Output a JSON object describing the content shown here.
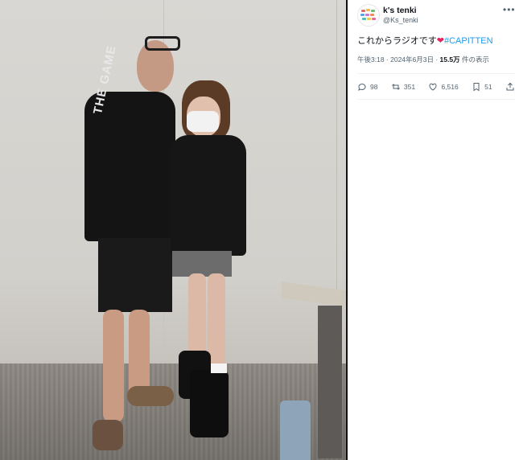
{
  "post": {
    "display_name": "k's tenki",
    "handle": "@Ks_tenki",
    "more_icon": "more-icon",
    "text_before": "これからラジオです",
    "heart_emoji": "❤",
    "hashtag": "#CAPITTEN",
    "time": "午後3:18",
    "date_sep": " · ",
    "date": "2024年6月3日",
    "views_sep": " · ",
    "views": "15.5万",
    "views_suffix": " 件の表示"
  },
  "actions": {
    "reply_count": "98",
    "retweet_count": "351",
    "like_count": "6,516",
    "bookmark_count": "51"
  },
  "photo": {
    "jacket_text": "THE GAME"
  },
  "colors": {
    "link": "#1d9bf0",
    "heart": "#e0245e",
    "secondary_text": "#536471"
  }
}
